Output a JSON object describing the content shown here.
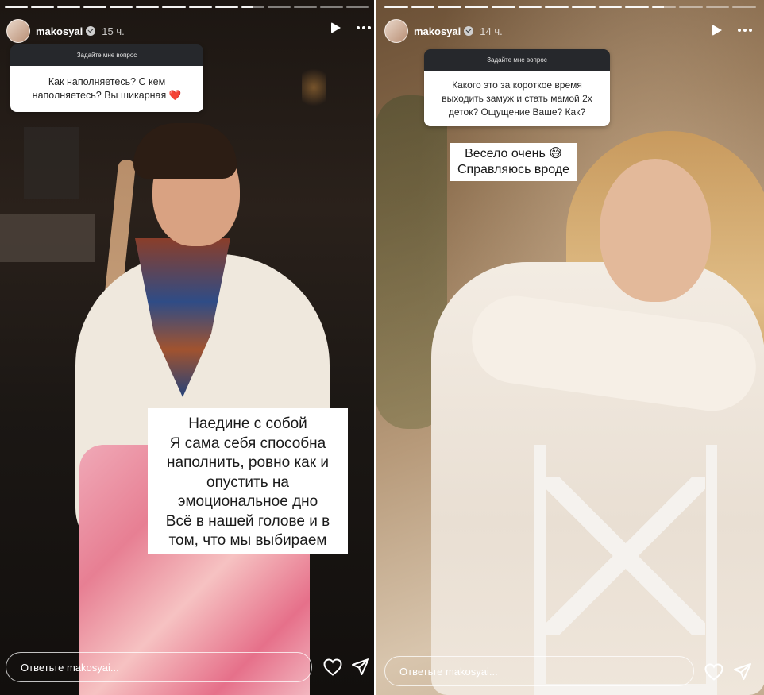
{
  "stories": [
    {
      "username": "makosyai",
      "time": "15 ч.",
      "progress": {
        "total": 14,
        "done": 9,
        "active_index": 9
      },
      "question": {
        "header": "Задайте мне вопрос",
        "lines": [
          "Как наполняетесь? С кем",
          "наполняетесь? Вы шикарная ❤️"
        ]
      },
      "answer_lines": [
        "Наедине с собой",
        "Я сама себя способна",
        "наполнить, ровно как и",
        "опустить на",
        "эмоциональное дно",
        "Всё в нашей голове и в",
        "том, что мы выбираем"
      ],
      "reply_placeholder": "Ответьте makosyai..."
    },
    {
      "username": "makosyai",
      "time": "14 ч.",
      "progress": {
        "total": 14,
        "done": 10,
        "active_index": 10
      },
      "question": {
        "header": "Задайте мне вопрос",
        "lines": [
          "Какого это за короткое время",
          "выходить замуж и стать мамой 2х",
          "деток? Ощущение Ваше? Как?"
        ]
      },
      "answer_lines": [
        "Весело очень 😅",
        "Справляюсь вроде"
      ],
      "reply_placeholder": "Ответьте makosyai..."
    }
  ],
  "icons": {
    "verified": "verified-badge-icon",
    "play": "play-icon",
    "more": "more-options-icon",
    "like": "heart-icon",
    "share": "send-icon"
  },
  "colors": {
    "sticker_header": "#26282c",
    "sticker_body": "#ffffff",
    "text_on_media": "#ffffff"
  }
}
